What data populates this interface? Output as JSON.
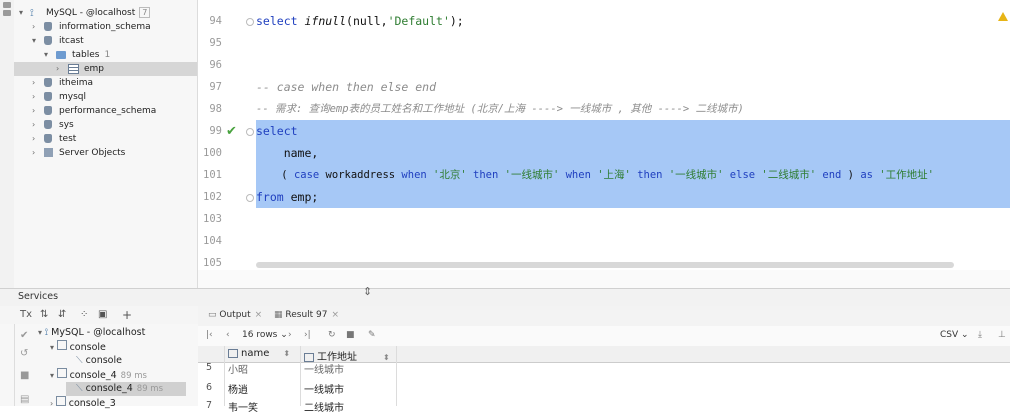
{
  "db_tree": {
    "connection": {
      "label": "MySQL - @localhost",
      "count": "7"
    },
    "schemas": [
      {
        "label": "information_schema"
      },
      {
        "label": "itcast"
      },
      {
        "label": "itheima"
      },
      {
        "label": "mysql"
      },
      {
        "label": "performance_schema"
      },
      {
        "label": "sys"
      },
      {
        "label": "test"
      }
    ],
    "tables_folder": {
      "label": "tables",
      "count": "1"
    },
    "table_emp": "emp",
    "server_objects": "Server Objects"
  },
  "editor": {
    "line_numbers": [
      "94",
      "95",
      "96",
      "97",
      "98",
      "99",
      "100",
      "101",
      "102",
      "103",
      "104",
      "105"
    ],
    "code": {
      "l94_select": "select ",
      "l94_fn": "ifnull",
      "l94_rest": "(null,",
      "l94_str": "'Default'",
      "l94_end": ");",
      "l97": "-- case when then else end",
      "l98": "-- 需求: 查询emp表的员工姓名和工作地址 (北京/上海 ----> 一线城市 , 其他 ----> 二线城市)",
      "l99": "select",
      "l100": "    name,",
      "l101_a": "    ( ",
      "l101_case": "case",
      "l101_col": " workaddress ",
      "l101_when1": "when",
      "l101_s1": " '北京' ",
      "l101_then1": "then",
      "l101_s2": " '一线城市' ",
      "l101_when2": "when",
      "l101_s3": " '上海' ",
      "l101_then2": "then",
      "l101_s4": " '一线城市' ",
      "l101_else": "else",
      "l101_s5": " '二线城市' ",
      "l101_end": "end",
      "l101_b": " ) ",
      "l101_as": "as",
      "l101_s6": " '工作地址'",
      "l102_from": "from",
      "l102_rest": " emp;"
    }
  },
  "services": {
    "title": "Services",
    "tree": {
      "root": "MySQL - @localhost",
      "console_group": "console",
      "console_child": "console",
      "console4_group": {
        "label": "console_4",
        "time": "89 ms"
      },
      "console4_child": {
        "label": "console_4",
        "time": "89 ms"
      },
      "console3": "console_3"
    }
  },
  "results": {
    "tabs": [
      {
        "label": "Output"
      },
      {
        "label": "Result 97"
      }
    ],
    "rows_label": "16 rows",
    "format": "CSV",
    "columns": [
      "name",
      "工作地址"
    ],
    "rows": [
      {
        "num": "5",
        "name": "小昭",
        "addr": "一线城市"
      },
      {
        "num": "6",
        "name": "杨逍",
        "addr": "一线城市"
      },
      {
        "num": "7",
        "name": "韦一笑",
        "addr": "二线城市"
      }
    ]
  },
  "colors": {
    "selection": "#a6c8f6",
    "keyword": "#1f3fbf",
    "string": "#2f7d32",
    "comment": "#8c8c8c"
  }
}
